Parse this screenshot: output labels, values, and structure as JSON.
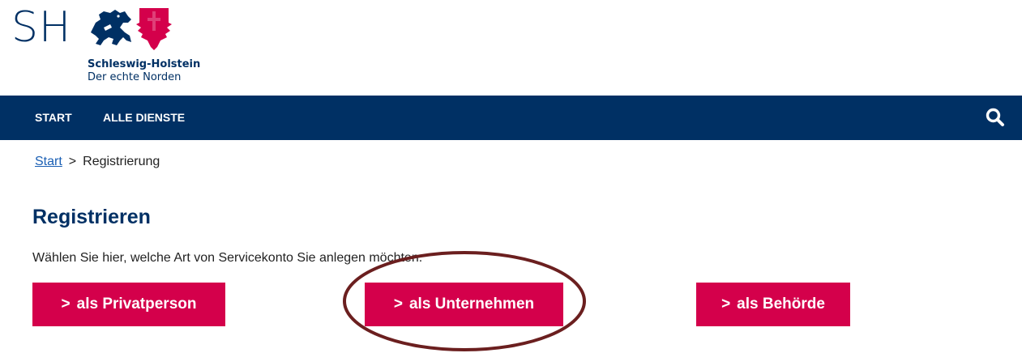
{
  "logo": {
    "short": "SH",
    "name": "Schleswig-Holstein",
    "slogan": "Der echte Norden",
    "colors": {
      "navy": "#003064",
      "red": "#d4004b"
    }
  },
  "nav": {
    "items": [
      {
        "label": "START"
      },
      {
        "label": "ALLE DIENSTE"
      }
    ],
    "search_icon": "search-icon"
  },
  "breadcrumb": {
    "home": "Start",
    "separator": ">",
    "current": "Registrierung"
  },
  "main": {
    "title": "Registrieren",
    "intro": "Wählen Sie hier, welche Art von Servicekonto Sie anlegen möchten.",
    "chevron": ">",
    "buttons": [
      {
        "label": "als Privatperson"
      },
      {
        "label": "als Unternehmen"
      },
      {
        "label": "als Behörde"
      }
    ]
  },
  "annotation": {
    "shape": "ellipse",
    "color": "#6b1f1f",
    "target": "als Unternehmen"
  }
}
